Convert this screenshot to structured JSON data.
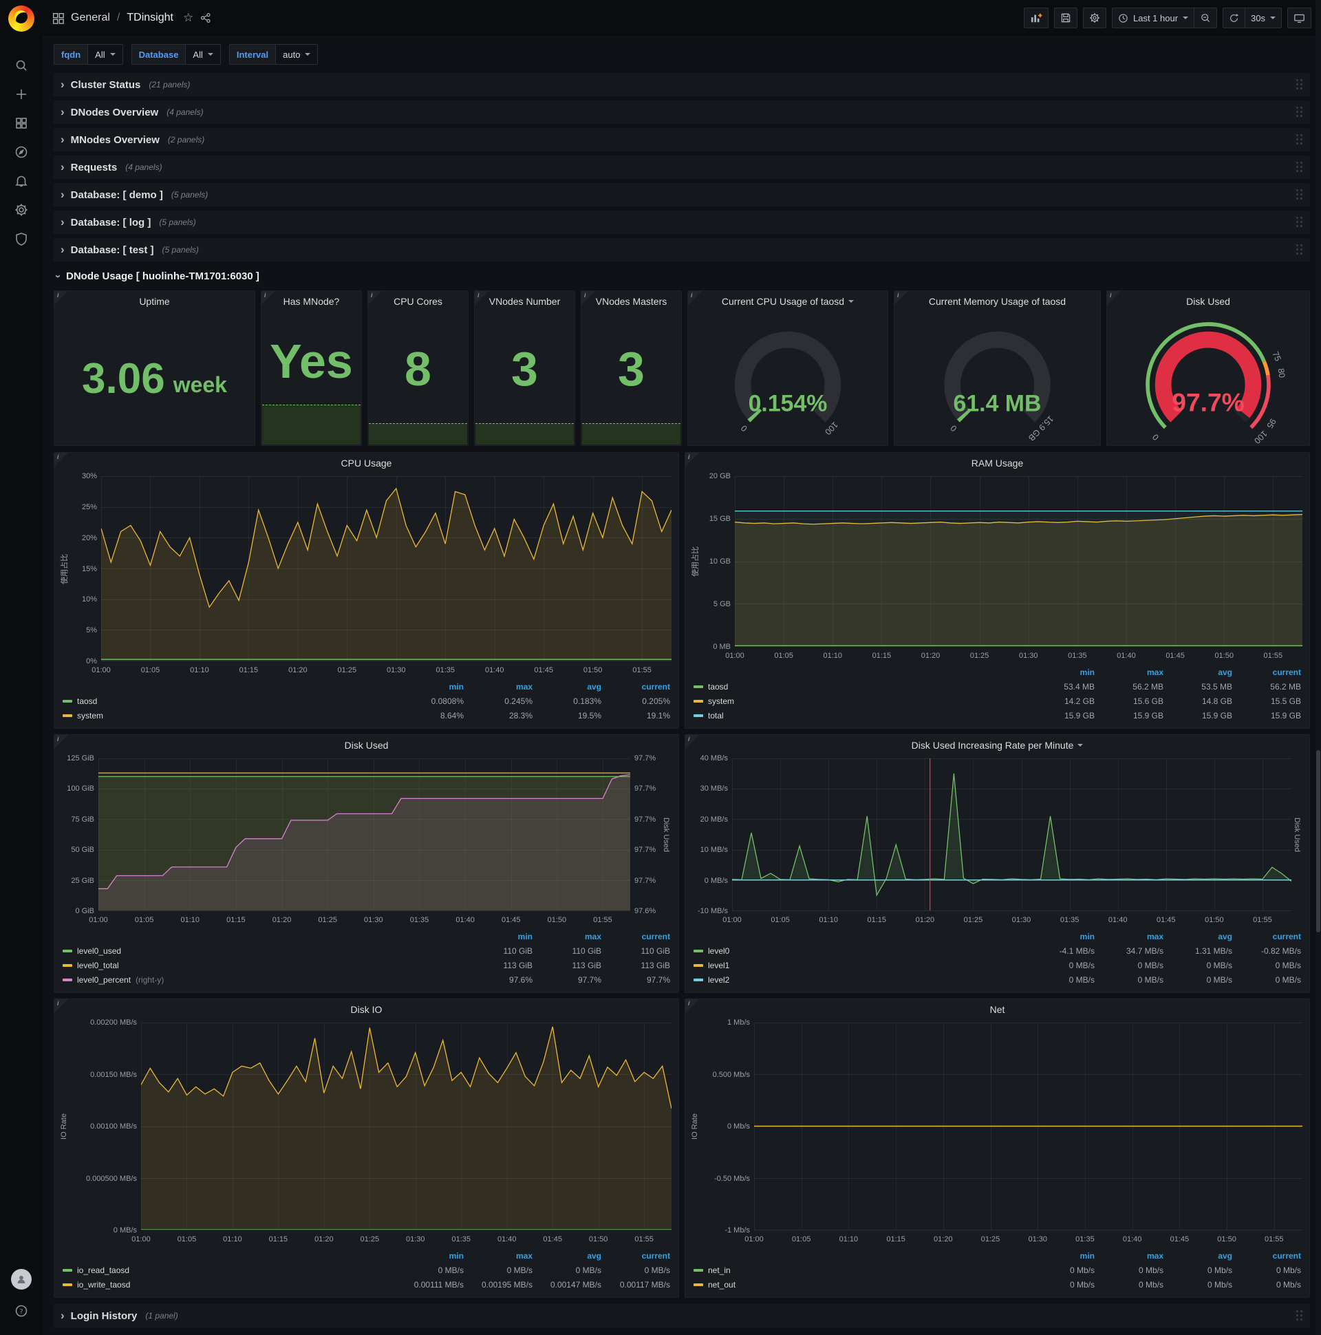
{
  "chrome": {
    "breadcrumb": {
      "section": "General",
      "sep": "/",
      "page": "TDinsight"
    },
    "time_label": "Last 1 hour",
    "refresh_label": "30s"
  },
  "sidebar": {
    "icons": [
      "search-icon",
      "plus-icon",
      "dashboards-icon",
      "explore-compass-icon",
      "alerting-bell-icon",
      "configuration-gear-icon",
      "server-admin-shield-icon"
    ],
    "bottom_icons": [
      "user-avatar",
      "help-icon"
    ]
  },
  "variables": [
    {
      "label": "fqdn",
      "value": "All"
    },
    {
      "label": "Database",
      "value": "All"
    },
    {
      "label": "Interval",
      "value": "auto"
    }
  ],
  "collapsed_rows": [
    {
      "title": "Cluster Status",
      "panels_label": "(21 panels)"
    },
    {
      "title": "DNodes Overview",
      "panels_label": "(4 panels)"
    },
    {
      "title": "MNodes Overview",
      "panels_label": "(2 panels)"
    },
    {
      "title": "Requests",
      "panels_label": "(4 panels)"
    },
    {
      "title": "Database: [ demo ]",
      "panels_label": "(5 panels)"
    },
    {
      "title": "Database: [ log ]",
      "panels_label": "(5 panels)"
    },
    {
      "title": "Database: [ test ]",
      "panels_label": "(5 panels)"
    }
  ],
  "dnode_row": {
    "title": "DNode Usage [ huolinhe-TM1701:6030 ]"
  },
  "login_row": {
    "title": "Login History",
    "panels_label": "(1 panel)"
  },
  "stats": [
    {
      "title": "Uptime",
      "value": "3.06",
      "unit": "week",
      "spark": 0
    },
    {
      "title": "Has MNode?",
      "value": "Yes",
      "unit": "",
      "spark": 0.26
    },
    {
      "title": "CPU Cores",
      "value": "8",
      "unit": "",
      "spark": 0.14
    },
    {
      "title": "VNodes Number",
      "value": "3",
      "unit": "",
      "spark": 0.14
    },
    {
      "title": "VNodes Masters",
      "value": "3",
      "unit": "",
      "spark": 0.14
    }
  ],
  "gauges": [
    {
      "title": "Current CPU Usage of taosd",
      "dropdown": true,
      "value": "0.154%",
      "percent": 0.154,
      "min_label": "0",
      "max_label": "100",
      "value_color": "#73bf69",
      "labels": []
    },
    {
      "title": "Current Memory Usage of taosd",
      "dropdown": false,
      "value": "61.4 MB",
      "percent": 0.38,
      "min_label": "0",
      "max_label": "15.9 GB",
      "value_color": "#73bf69",
      "labels": []
    },
    {
      "title": "Disk Used",
      "dropdown": false,
      "value": "97.7%",
      "percent": 97.7,
      "min_label": "",
      "max_label": "",
      "value_color": "#f2495c",
      "thresholds": [
        {
          "to": 75,
          "color": "#73bf69"
        },
        {
          "to": 80,
          "color": "#ff9830"
        },
        {
          "to": 100,
          "color": "#f2495c"
        }
      ],
      "labels": [
        {
          "t": "0",
          "p": 0
        },
        {
          "t": "75",
          "p": 75
        },
        {
          "t": "80",
          "p": 80
        },
        {
          "t": "95",
          "p": 95
        },
        {
          "t": "100",
          "p": 100
        }
      ]
    }
  ],
  "chart_data": [
    {
      "id": "cpu",
      "type": "line",
      "title": "CPU Usage",
      "dropdown": false,
      "ylabel_left": "使用占比",
      "ylabel_right": "",
      "yaxis_width": 46,
      "y": {
        "min": 0,
        "max": 30,
        "ticks": [
          "0%",
          "5%",
          "10%",
          "15%",
          "20%",
          "25%",
          "30%"
        ]
      },
      "x_ticks": [
        "01:00",
        "01:05",
        "01:10",
        "01:15",
        "01:20",
        "01:25",
        "01:30",
        "01:35",
        "01:40",
        "01:45",
        "01:50",
        "01:55"
      ],
      "x_domain_minutes": 58,
      "series": [
        {
          "name": "system",
          "color": "#eab839",
          "fill": 0.14,
          "values": [
            21.5,
            16,
            21,
            22,
            19.5,
            15.5,
            21,
            18.5,
            17,
            20,
            14,
            8.7,
            11,
            13,
            9.8,
            16,
            24.5,
            20,
            15,
            19,
            22.5,
            18,
            25.5,
            21,
            17,
            22,
            19.5,
            24.5,
            20,
            26,
            28,
            22,
            18.5,
            21,
            24,
            19,
            27.5,
            27,
            22,
            18,
            21.5,
            17,
            23,
            20,
            16.5,
            22,
            25.5,
            19,
            23.5,
            18,
            24,
            20,
            26.5,
            22,
            19,
            27.5,
            26,
            21,
            24.5
          ]
        },
        {
          "name": "taosd",
          "color": "#73bf69",
          "fill": 0,
          "const": 0.2
        }
      ],
      "legend": {
        "cols": [
          "min",
          "max",
          "avg",
          "current"
        ],
        "rows": [
          {
            "name": "taosd",
            "color": "#73bf69",
            "values": [
              "0.0808%",
              "0.245%",
              "0.183%",
              "0.205%"
            ]
          },
          {
            "name": "system",
            "color": "#eab839",
            "values": [
              "8.64%",
              "28.3%",
              "19.5%",
              "19.1%"
            ]
          }
        ]
      }
    },
    {
      "id": "ram",
      "type": "line",
      "title": "RAM Usage",
      "dropdown": false,
      "ylabel_left": "使用占比",
      "ylabel_right": "",
      "yaxis_width": 50,
      "y": {
        "min": 0,
        "max": 20,
        "ticks": [
          "0 MB",
          "5 GB",
          "10 GB",
          "15 GB",
          "20 GB"
        ]
      },
      "x_ticks": [
        "01:00",
        "01:05",
        "01:10",
        "01:15",
        "01:20",
        "01:25",
        "01:30",
        "01:35",
        "01:40",
        "01:45",
        "01:50",
        "01:55"
      ],
      "x_domain_minutes": 58,
      "series": [
        {
          "name": "system",
          "color": "#eab839",
          "fill": 0.13,
          "values": [
            14.6,
            14.5,
            14.45,
            14.5,
            14.4,
            14.45,
            14.5,
            14.4,
            14.35,
            14.4,
            14.45,
            14.5,
            14.45,
            14.4,
            14.45,
            14.5,
            14.55,
            14.5,
            14.45,
            14.5,
            14.55,
            14.6,
            14.5,
            14.45,
            14.5,
            14.55,
            14.5,
            14.6,
            14.55,
            14.5,
            14.6,
            14.65,
            14.6,
            14.55,
            14.6,
            14.7,
            14.65,
            14.6,
            14.7,
            14.75,
            14.7,
            14.75,
            14.8,
            14.85,
            14.9,
            15.0,
            15.1,
            15.2,
            15.3,
            15.35,
            15.3,
            15.35,
            15.4,
            15.35,
            15.4,
            15.45,
            15.4,
            15.45,
            15.5
          ]
        },
        {
          "name": "total",
          "color": "#6ed0e0",
          "fill": 0.05,
          "const": 15.9
        },
        {
          "name": "taosd",
          "color": "#73bf69",
          "fill": 0,
          "const": 0.055
        }
      ],
      "legend": {
        "cols": [
          "min",
          "max",
          "avg",
          "current"
        ],
        "rows": [
          {
            "name": "taosd",
            "color": "#73bf69",
            "values": [
              "53.4 MB",
              "56.2 MB",
              "53.5 MB",
              "56.2 MB"
            ]
          },
          {
            "name": "system",
            "color": "#eab839",
            "values": [
              "14.2 GB",
              "15.6 GB",
              "14.8 GB",
              "15.5 GB"
            ]
          },
          {
            "name": "total",
            "color": "#6ed0e0",
            "values": [
              "15.9 GB",
              "15.9 GB",
              "15.9 GB",
              "15.9 GB"
            ]
          }
        ]
      }
    },
    {
      "id": "disk",
      "type": "line",
      "title": "Disk Used",
      "dropdown": false,
      "ylabel_left": "",
      "ylabel_right": "Disk Used",
      "yaxis_width": 58,
      "y": {
        "min": 0,
        "max": 125,
        "ticks": [
          "0 GiB",
          "25 GiB",
          "50 GiB",
          "75 GiB",
          "100 GiB",
          "125 GiB"
        ]
      },
      "y2": {
        "min": 97.58,
        "max": 97.72,
        "ticks": [
          "97.6%",
          "97.7%",
          "97.7%",
          "97.7%",
          "97.7%",
          "97.7%"
        ]
      },
      "x_ticks": [
        "01:00",
        "01:05",
        "01:10",
        "01:15",
        "01:20",
        "01:25",
        "01:30",
        "01:35",
        "01:40",
        "01:45",
        "01:50",
        "01:55"
      ],
      "x_domain_minutes": 58,
      "series": [
        {
          "name": "level0_used",
          "color": "#73bf69",
          "fill": 0.12,
          "const": 110
        },
        {
          "name": "level0_total",
          "color": "#eab839",
          "fill": 0.08,
          "const": 113
        },
        {
          "name": "level0_percent",
          "color": "#d683ce",
          "fill": 0.12,
          "axis": "right",
          "values": [
            97.6,
            97.6,
            97.612,
            97.612,
            97.612,
            97.612,
            97.612,
            97.612,
            97.62,
            97.62,
            97.62,
            97.62,
            97.62,
            97.62,
            97.62,
            97.638,
            97.646,
            97.646,
            97.646,
            97.646,
            97.646,
            97.663,
            97.663,
            97.663,
            97.663,
            97.663,
            97.669,
            97.669,
            97.669,
            97.669,
            97.669,
            97.669,
            97.669,
            97.683,
            97.683,
            97.683,
            97.683,
            97.683,
            97.683,
            97.683,
            97.683,
            97.683,
            97.683,
            97.683,
            97.683,
            97.683,
            97.683,
            97.683,
            97.683,
            97.683,
            97.683,
            97.683,
            97.683,
            97.683,
            97.683,
            97.683,
            97.701,
            97.704,
            97.705
          ]
        }
      ],
      "legend": {
        "cols": [
          "min",
          "max",
          "current"
        ],
        "rows": [
          {
            "name": "level0_used",
            "color": "#73bf69",
            "values": [
              "110 GiB",
              "110 GiB",
              "110 GiB"
            ]
          },
          {
            "name": "level0_total",
            "color": "#eab839",
            "values": [
              "113 GiB",
              "113 GiB",
              "113 GiB"
            ]
          },
          {
            "name": "level0_percent",
            "suffix": "(right-y)",
            "color": "#d683ce",
            "values": [
              "97.6%",
              "97.7%",
              "97.7%"
            ]
          }
        ]
      }
    },
    {
      "id": "rate",
      "type": "line",
      "title": "Disk Used Increasing Rate per Minute",
      "dropdown": true,
      "ylabel_left": "",
      "ylabel_right": "Disk Used",
      "yaxis_width": 62,
      "y": {
        "min": -10,
        "max": 40,
        "ticks": [
          "-10 MB/s",
          "0 MB/s",
          "10 MB/s",
          "20 MB/s",
          "30 MB/s",
          "40 MB/s"
        ]
      },
      "x_ticks": [
        "01:00",
        "01:05",
        "01:10",
        "01:15",
        "01:20",
        "01:25",
        "01:30",
        "01:35",
        "01:40",
        "01:45",
        "01:50",
        "01:55"
      ],
      "x_domain_minutes": 58,
      "annotation": {
        "x_fraction": 0.354,
        "color": "#f2495c"
      },
      "series": [
        {
          "name": "level0",
          "color": "#73bf69",
          "fill": 0.15,
          "values": [
            0.2,
            0.1,
            15.5,
            0.5,
            2.2,
            0.2,
            0.1,
            11.2,
            0.4,
            0.2,
            0.1,
            -0.6,
            0.2,
            0.1,
            21,
            -5,
            0.5,
            11.6,
            0.3,
            0.1,
            0.2,
            0.4,
            0.2,
            35,
            0.6,
            -1.2,
            0.3,
            0.2,
            0.1,
            0.4,
            0.2,
            0.1,
            0.3,
            21,
            0.4,
            0.2,
            0.3,
            0.1,
            0.4,
            0.2,
            0.3,
            0.4,
            0.2,
            0.3,
            0.1,
            0.4,
            0.3,
            0.2,
            0.4,
            0.3,
            0.4,
            0.3,
            0.4,
            0.3,
            0.4,
            0.3,
            4.2,
            2.1,
            -0.4
          ]
        },
        {
          "name": "level1",
          "color": "#eab839",
          "fill": 0,
          "const": 0
        },
        {
          "name": "level2",
          "color": "#6ed0e0",
          "fill": 0,
          "const": 0
        }
      ],
      "legend": {
        "cols": [
          "min",
          "max",
          "avg",
          "current"
        ],
        "rows": [
          {
            "name": "level0",
            "color": "#73bf69",
            "values": [
              "-4.1 MB/s",
              "34.7 MB/s",
              "1.31 MB/s",
              "-0.82 MB/s"
            ]
          },
          {
            "name": "level1",
            "color": "#eab839",
            "values": [
              "0 MB/s",
              "0 MB/s",
              "0 MB/s",
              "0 MB/s"
            ]
          },
          {
            "name": "level2",
            "color": "#6ed0e0",
            "values": [
              "0 MB/s",
              "0 MB/s",
              "0 MB/s",
              "0 MB/s"
            ]
          }
        ]
      }
    },
    {
      "id": "io",
      "type": "line",
      "title": "Disk IO",
      "dropdown": false,
      "ylabel_left": "IO Rate",
      "ylabel_right": "",
      "yaxis_width": 104,
      "y": {
        "min": 0,
        "max": 0.002,
        "ticks": [
          "0 MB/s",
          "0.000500 MB/s",
          "0.00100 MB/s",
          "0.00150 MB/s",
          "0.00200 MB/s"
        ]
      },
      "x_ticks": [
        "01:00",
        "01:05",
        "01:10",
        "01:15",
        "01:20",
        "01:25",
        "01:30",
        "01:35",
        "01:40",
        "01:45",
        "01:50",
        "01:55"
      ],
      "x_domain_minutes": 58,
      "series": [
        {
          "name": "io_write_taosd",
          "color": "#eab839",
          "fill": 0.13,
          "values": [
            0.0014,
            0.00156,
            0.00142,
            0.00133,
            0.00146,
            0.0013,
            0.00138,
            0.00131,
            0.00136,
            0.00129,
            0.00152,
            0.00158,
            0.00156,
            0.00161,
            0.00144,
            0.00131,
            0.00144,
            0.00158,
            0.00143,
            0.00185,
            0.00132,
            0.00158,
            0.00146,
            0.00172,
            0.00136,
            0.00195,
            0.00152,
            0.00161,
            0.00138,
            0.00148,
            0.00171,
            0.00139,
            0.00157,
            0.00183,
            0.00144,
            0.00152,
            0.00138,
            0.00166,
            0.00151,
            0.00142,
            0.00156,
            0.00171,
            0.00148,
            0.00139,
            0.00162,
            0.00196,
            0.00142,
            0.00154,
            0.00146,
            0.00168,
            0.00138,
            0.00157,
            0.00149,
            0.00164,
            0.00143,
            0.00152,
            0.00146,
            0.00158,
            0.00117
          ]
        },
        {
          "name": "io_read_taosd",
          "color": "#73bf69",
          "fill": 0,
          "const": 0
        }
      ],
      "legend": {
        "cols": [
          "min",
          "max",
          "avg",
          "current"
        ],
        "rows": [
          {
            "name": "io_read_taosd",
            "color": "#73bf69",
            "values": [
              "0 MB/s",
              "0 MB/s",
              "0 MB/s",
              "0 MB/s"
            ]
          },
          {
            "name": "io_write_taosd",
            "color": "#eab839",
            "values": [
              "0.00111 MB/s",
              "0.00195 MB/s",
              "0.00147 MB/s",
              "0.00117 MB/s"
            ]
          }
        ]
      }
    },
    {
      "id": "net",
      "type": "line",
      "title": "Net",
      "dropdown": false,
      "ylabel_left": "IO Rate",
      "ylabel_right": "",
      "yaxis_width": 78,
      "y": {
        "min": -1,
        "max": 1,
        "ticks": [
          "-1 Mb/s",
          "-0.50 Mb/s",
          "0 Mb/s",
          "0.500 Mb/s",
          "1 Mb/s"
        ]
      },
      "x_ticks": [
        "01:00",
        "01:05",
        "01:10",
        "01:15",
        "01:20",
        "01:25",
        "01:30",
        "01:35",
        "01:40",
        "01:45",
        "01:50",
        "01:55"
      ],
      "x_domain_minutes": 58,
      "series": [
        {
          "name": "net_in",
          "color": "#73bf69",
          "fill": 0,
          "const": 0
        },
        {
          "name": "net_out",
          "color": "#eab839",
          "fill": 0,
          "const": 0
        }
      ],
      "legend": {
        "cols": [
          "min",
          "max",
          "avg",
          "current"
        ],
        "rows": [
          {
            "name": "net_in",
            "color": "#73bf69",
            "values": [
              "0 Mb/s",
              "0 Mb/s",
              "0 Mb/s",
              "0 Mb/s"
            ]
          },
          {
            "name": "net_out",
            "color": "#eab839",
            "values": [
              "0 Mb/s",
              "0 Mb/s",
              "0 Mb/s",
              "0 Mb/s"
            ]
          }
        ]
      }
    }
  ]
}
